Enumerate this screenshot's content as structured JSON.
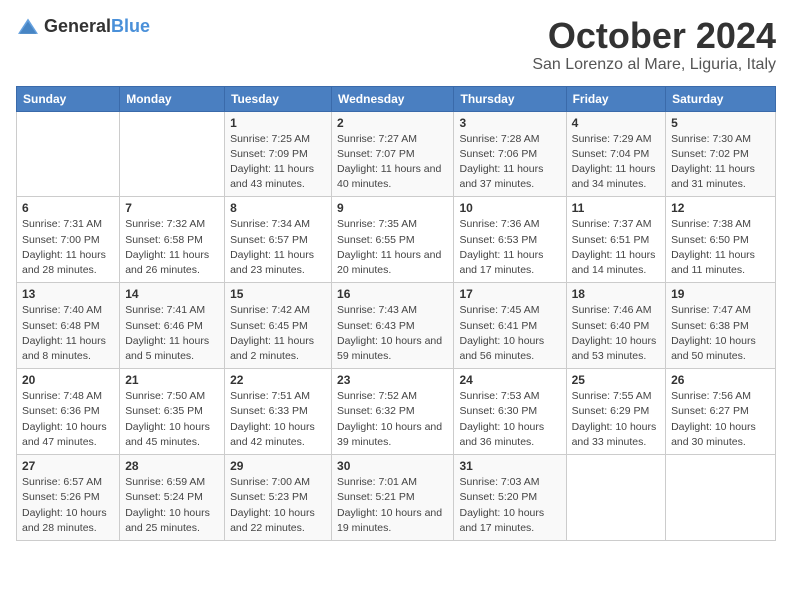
{
  "header": {
    "logo_general": "General",
    "logo_blue": "Blue",
    "month_title": "October 2024",
    "location": "San Lorenzo al Mare, Liguria, Italy"
  },
  "days_of_week": [
    "Sunday",
    "Monday",
    "Tuesday",
    "Wednesday",
    "Thursday",
    "Friday",
    "Saturday"
  ],
  "weeks": [
    [
      {
        "day": "",
        "info": ""
      },
      {
        "day": "",
        "info": ""
      },
      {
        "day": "1",
        "info": "Sunrise: 7:25 AM\nSunset: 7:09 PM\nDaylight: 11 hours and 43 minutes."
      },
      {
        "day": "2",
        "info": "Sunrise: 7:27 AM\nSunset: 7:07 PM\nDaylight: 11 hours and 40 minutes."
      },
      {
        "day": "3",
        "info": "Sunrise: 7:28 AM\nSunset: 7:06 PM\nDaylight: 11 hours and 37 minutes."
      },
      {
        "day": "4",
        "info": "Sunrise: 7:29 AM\nSunset: 7:04 PM\nDaylight: 11 hours and 34 minutes."
      },
      {
        "day": "5",
        "info": "Sunrise: 7:30 AM\nSunset: 7:02 PM\nDaylight: 11 hours and 31 minutes."
      }
    ],
    [
      {
        "day": "6",
        "info": "Sunrise: 7:31 AM\nSunset: 7:00 PM\nDaylight: 11 hours and 28 minutes."
      },
      {
        "day": "7",
        "info": "Sunrise: 7:32 AM\nSunset: 6:58 PM\nDaylight: 11 hours and 26 minutes."
      },
      {
        "day": "8",
        "info": "Sunrise: 7:34 AM\nSunset: 6:57 PM\nDaylight: 11 hours and 23 minutes."
      },
      {
        "day": "9",
        "info": "Sunrise: 7:35 AM\nSunset: 6:55 PM\nDaylight: 11 hours and 20 minutes."
      },
      {
        "day": "10",
        "info": "Sunrise: 7:36 AM\nSunset: 6:53 PM\nDaylight: 11 hours and 17 minutes."
      },
      {
        "day": "11",
        "info": "Sunrise: 7:37 AM\nSunset: 6:51 PM\nDaylight: 11 hours and 14 minutes."
      },
      {
        "day": "12",
        "info": "Sunrise: 7:38 AM\nSunset: 6:50 PM\nDaylight: 11 hours and 11 minutes."
      }
    ],
    [
      {
        "day": "13",
        "info": "Sunrise: 7:40 AM\nSunset: 6:48 PM\nDaylight: 11 hours and 8 minutes."
      },
      {
        "day": "14",
        "info": "Sunrise: 7:41 AM\nSunset: 6:46 PM\nDaylight: 11 hours and 5 minutes."
      },
      {
        "day": "15",
        "info": "Sunrise: 7:42 AM\nSunset: 6:45 PM\nDaylight: 11 hours and 2 minutes."
      },
      {
        "day": "16",
        "info": "Sunrise: 7:43 AM\nSunset: 6:43 PM\nDaylight: 10 hours and 59 minutes."
      },
      {
        "day": "17",
        "info": "Sunrise: 7:45 AM\nSunset: 6:41 PM\nDaylight: 10 hours and 56 minutes."
      },
      {
        "day": "18",
        "info": "Sunrise: 7:46 AM\nSunset: 6:40 PM\nDaylight: 10 hours and 53 minutes."
      },
      {
        "day": "19",
        "info": "Sunrise: 7:47 AM\nSunset: 6:38 PM\nDaylight: 10 hours and 50 minutes."
      }
    ],
    [
      {
        "day": "20",
        "info": "Sunrise: 7:48 AM\nSunset: 6:36 PM\nDaylight: 10 hours and 47 minutes."
      },
      {
        "day": "21",
        "info": "Sunrise: 7:50 AM\nSunset: 6:35 PM\nDaylight: 10 hours and 45 minutes."
      },
      {
        "day": "22",
        "info": "Sunrise: 7:51 AM\nSunset: 6:33 PM\nDaylight: 10 hours and 42 minutes."
      },
      {
        "day": "23",
        "info": "Sunrise: 7:52 AM\nSunset: 6:32 PM\nDaylight: 10 hours and 39 minutes."
      },
      {
        "day": "24",
        "info": "Sunrise: 7:53 AM\nSunset: 6:30 PM\nDaylight: 10 hours and 36 minutes."
      },
      {
        "day": "25",
        "info": "Sunrise: 7:55 AM\nSunset: 6:29 PM\nDaylight: 10 hours and 33 minutes."
      },
      {
        "day": "26",
        "info": "Sunrise: 7:56 AM\nSunset: 6:27 PM\nDaylight: 10 hours and 30 minutes."
      }
    ],
    [
      {
        "day": "27",
        "info": "Sunrise: 6:57 AM\nSunset: 5:26 PM\nDaylight: 10 hours and 28 minutes."
      },
      {
        "day": "28",
        "info": "Sunrise: 6:59 AM\nSunset: 5:24 PM\nDaylight: 10 hours and 25 minutes."
      },
      {
        "day": "29",
        "info": "Sunrise: 7:00 AM\nSunset: 5:23 PM\nDaylight: 10 hours and 22 minutes."
      },
      {
        "day": "30",
        "info": "Sunrise: 7:01 AM\nSunset: 5:21 PM\nDaylight: 10 hours and 19 minutes."
      },
      {
        "day": "31",
        "info": "Sunrise: 7:03 AM\nSunset: 5:20 PM\nDaylight: 10 hours and 17 minutes."
      },
      {
        "day": "",
        "info": ""
      },
      {
        "day": "",
        "info": ""
      }
    ]
  ]
}
